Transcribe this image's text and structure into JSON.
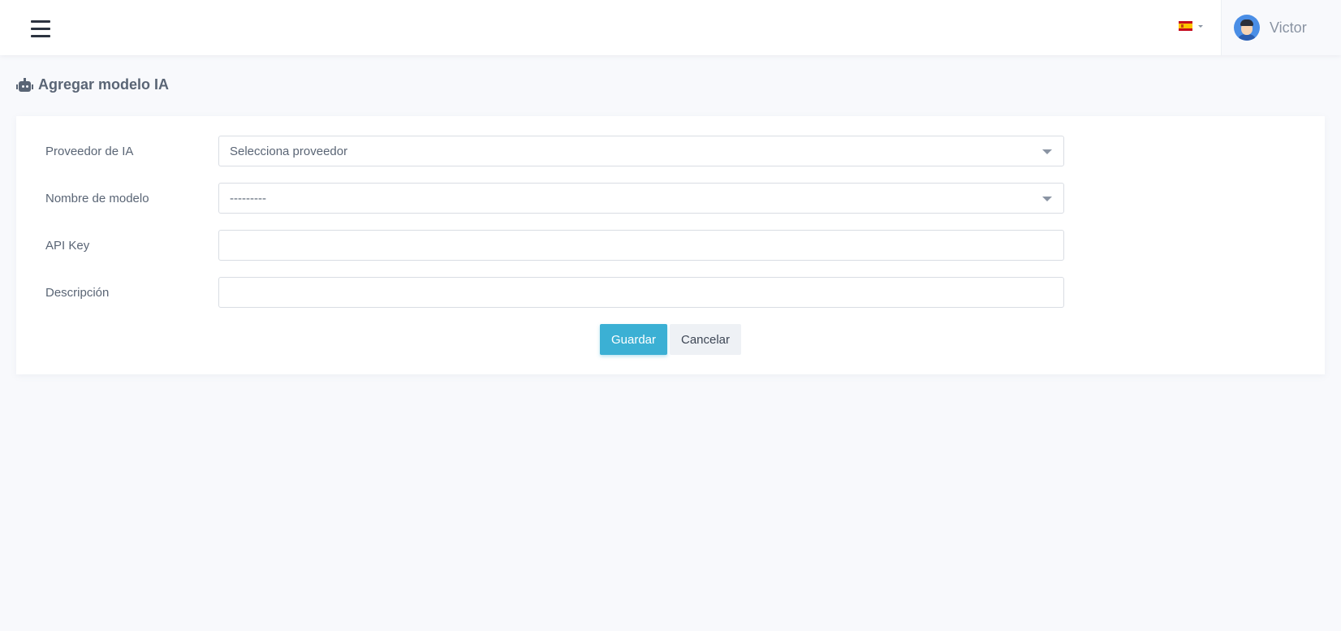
{
  "header": {
    "menu_icon": "hamburger-icon",
    "language_flag": "spain-flag-icon",
    "user_name": "Victor"
  },
  "page": {
    "title": "Agregar modelo IA",
    "title_icon": "robot-icon"
  },
  "form": {
    "provider": {
      "label": "Proveedor de IA",
      "value": "Selecciona proveedor"
    },
    "model": {
      "label": "Nombre de modelo",
      "value": "---------"
    },
    "api_key": {
      "label": "API Key",
      "value": ""
    },
    "description": {
      "label": "Descripción",
      "value": ""
    },
    "save_label": "Guardar",
    "cancel_label": "Cancelar"
  },
  "colors": {
    "primary": "#3bb0d4",
    "background": "#f8f9fc"
  }
}
